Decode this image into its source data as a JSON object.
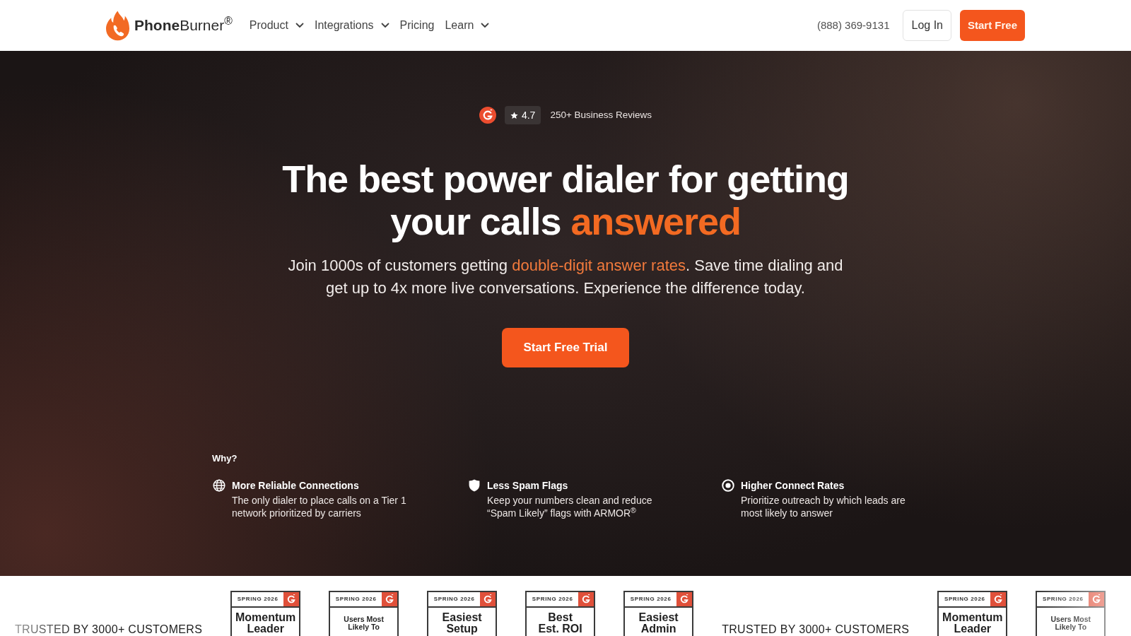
{
  "header": {
    "logo": {
      "text": "**Phone**Burner$^{®}$"
    },
    "nav": [
      {
        "label": "Product",
        "kind": "dropdown"
      },
      {
        "label": "Integrations",
        "kind": "dropdown"
      },
      {
        "label": "Pricing",
        "kind": "link"
      },
      {
        "label": "Learn",
        "kind": "dropdown"
      }
    ],
    "phone": "(888) 369-9131",
    "buttons": [
      {
        "label": "Log In",
        "kind": "secondary"
      },
      {
        "label": "Start Free",
        "kind": "primary"
      }
    ]
  },
  "hero": {
    "rating": {
      "score": "4.7",
      "reviews": "250+ Business Reviews"
    },
    "headline": {
      "text": "The best power dialer for getting your calls ",
      "highlight": "answered"
    },
    "subtitle": {
      "before": "Join 1000s of customers getting ",
      "highlight": "double-digit answer rates",
      "after": ". Save time dialing and get up to 4x more live conversations. Experience the difference today."
    },
    "cta": "Start Free Trial",
    "why": {
      "heading": "Why?",
      "features": [
        {
          "title": "More Reliable Connections",
          "description": "The only dialer to place calls on a Tier 1 network prioritized by carriers"
        },
        {
          "title": "Less Spam Flags",
          "description": "Keep your numbers clean and reduce “Spam Likely” flags with ARMOR$^{®}$"
        },
        {
          "title": "Higher Connect Rates",
          "description": "Prioritize outreach by which leads are most likely to answer"
        }
      ]
    }
  },
  "trust_strip": [
    {
      "kind": "text",
      "text": "TRUSTED BY 3000+ CUSTOMERS"
    },
    {
      "kind": "badge",
      "season": "SPRING 2026",
      "title": "Momentum\nLeader"
    },
    {
      "kind": "badge",
      "season": "SPRING 2026",
      "title": "Users Most\nLikely To"
    },
    {
      "kind": "badge",
      "season": "SPRING 2026",
      "title": "Easiest\nSetup"
    },
    {
      "kind": "badge",
      "season": "SPRING 2026",
      "title": "Best\nEst. ROI"
    },
    {
      "kind": "badge",
      "season": "SPRING 2026",
      "title": "Easiest\nAdmin"
    },
    {
      "kind": "text",
      "text": "TRUSTED BY 3000+ CUSTOMERS"
    },
    {
      "kind": "badge",
      "season": "SPRING 2026",
      "title": "Momentum\nLeader"
    },
    {
      "kind": "badge",
      "season": "SPRING 2026",
      "title": "Users Most\nLikely To"
    }
  ]
}
